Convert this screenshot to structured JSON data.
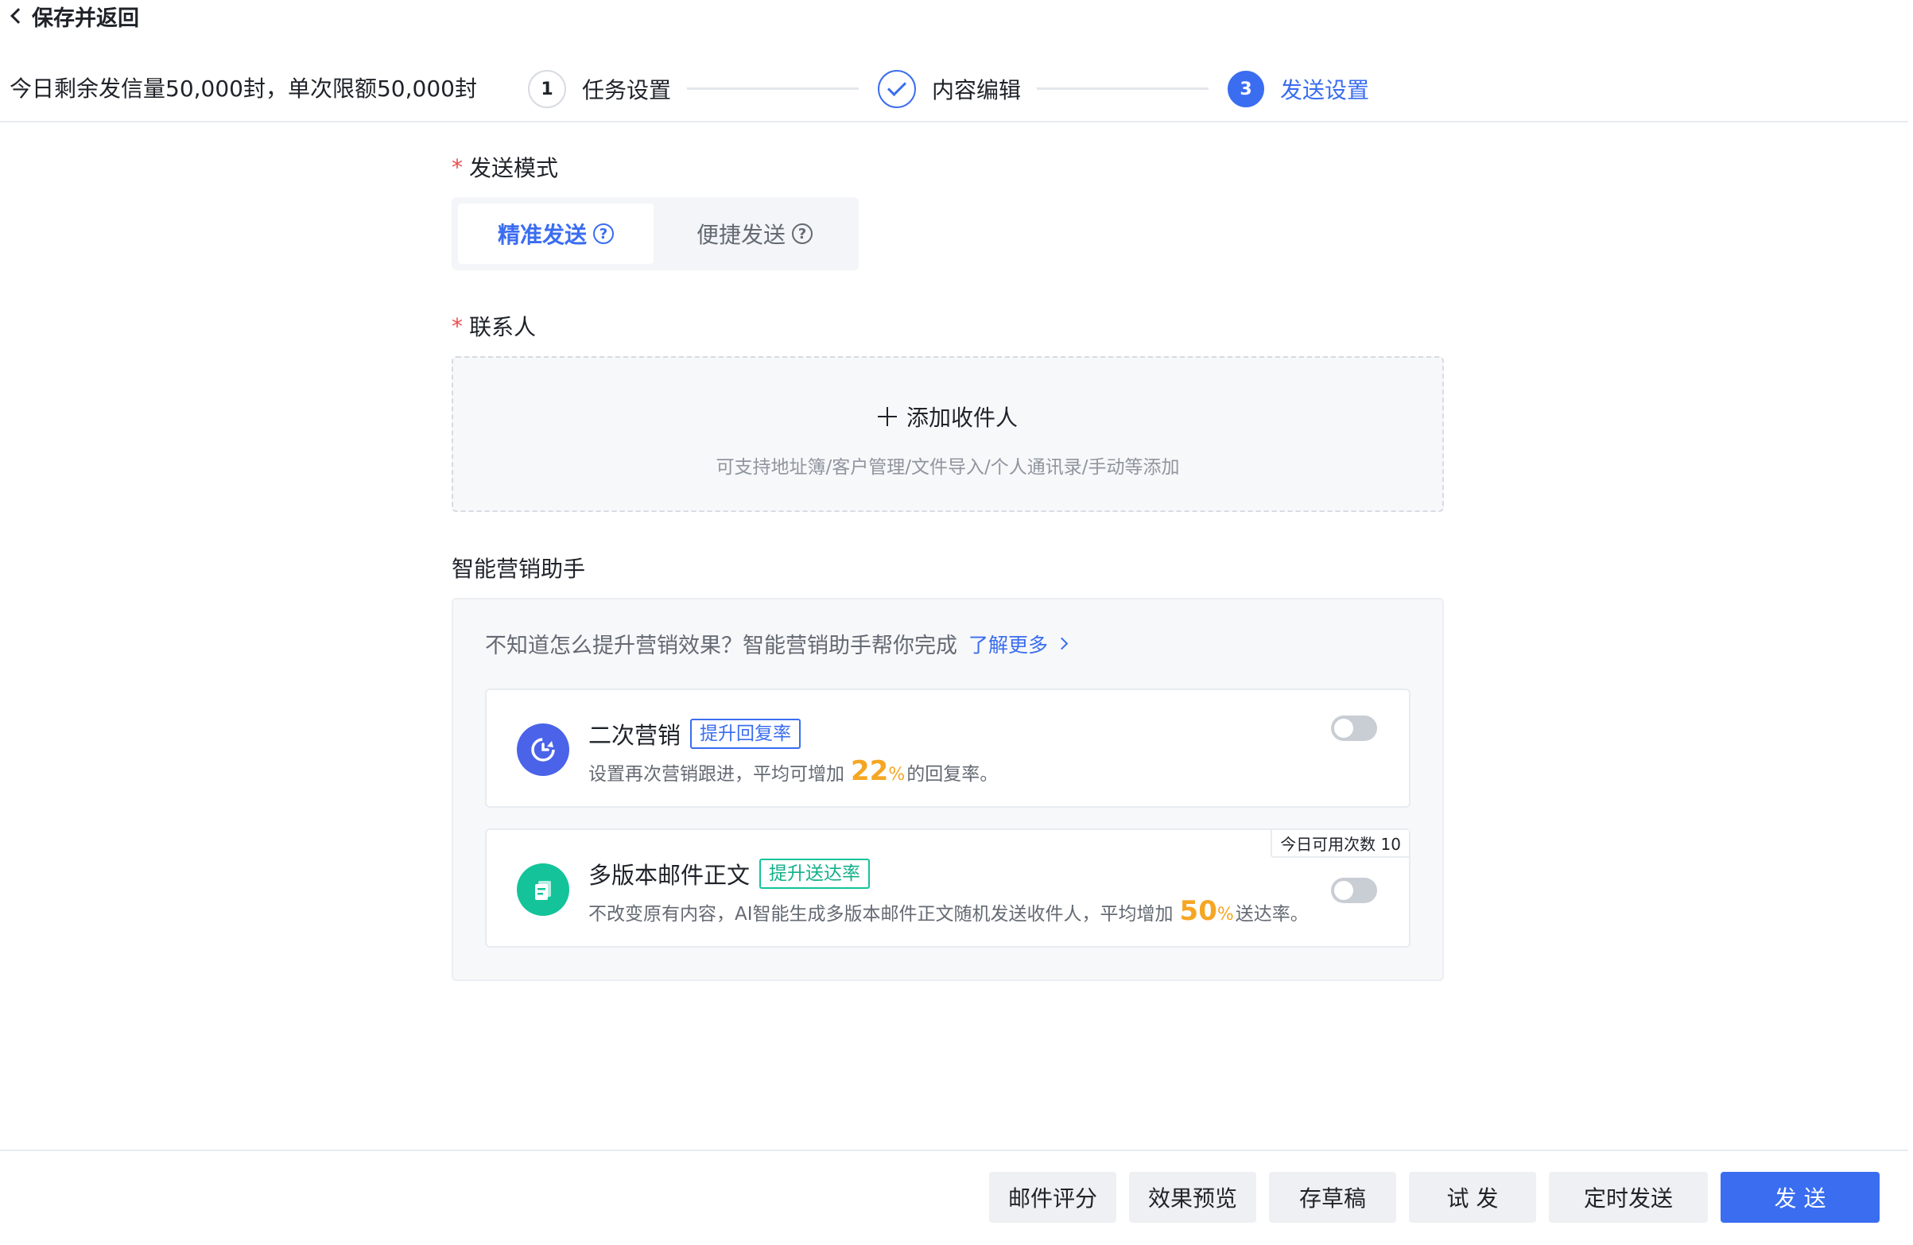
{
  "nav": {
    "back_label": "保存并返回"
  },
  "header": {
    "quota": "今日剩余发信量50,000封，单次限额50,000封",
    "steps": [
      {
        "num": "1",
        "label": "任务设置"
      },
      {
        "num": "",
        "label": "内容编辑"
      },
      {
        "num": "3",
        "label": "发送设置"
      }
    ]
  },
  "send_mode": {
    "label": "发送模式",
    "options": [
      {
        "label": "精准发送"
      },
      {
        "label": "便捷发送"
      }
    ],
    "help_glyph": "?"
  },
  "contacts": {
    "label": "联系人",
    "add_label": "添加收件人",
    "hint": "可支持地址簿/客户管理/文件导入/个人通讯录/手动等添加"
  },
  "assistant": {
    "label": "智能营销助手",
    "intro": "不知道怎么提升营销效果？智能营销助手帮你完成",
    "more_label": "了解更多",
    "cards": [
      {
        "title": "二次营销",
        "tag": "提升回复率",
        "desc_prefix": "设置再次营销跟进，平均可增加",
        "big_value": "22",
        "unit": "%",
        "desc_suffix": "的回复率。",
        "enabled": false
      },
      {
        "title": "多版本邮件正文",
        "tag": "提升送达率",
        "desc_prefix": "不改变原有内容，AI智能生成多版本邮件正文随机发送收件人，平均增加",
        "big_value": "50",
        "unit": "%",
        "desc_suffix": "送达率。",
        "quota_badge": "今日可用次数 10",
        "enabled": false
      }
    ]
  },
  "footer": {
    "buttons": [
      "邮件评分",
      "效果预览",
      "存草稿",
      "试 发",
      "定时发送",
      "发 送"
    ]
  },
  "colors": {
    "primary": "#3a6df0",
    "required": "#f04b4b",
    "highlight": "#f5a623",
    "icon_blue": "#4a63e8",
    "icon_green": "#14c39a"
  }
}
